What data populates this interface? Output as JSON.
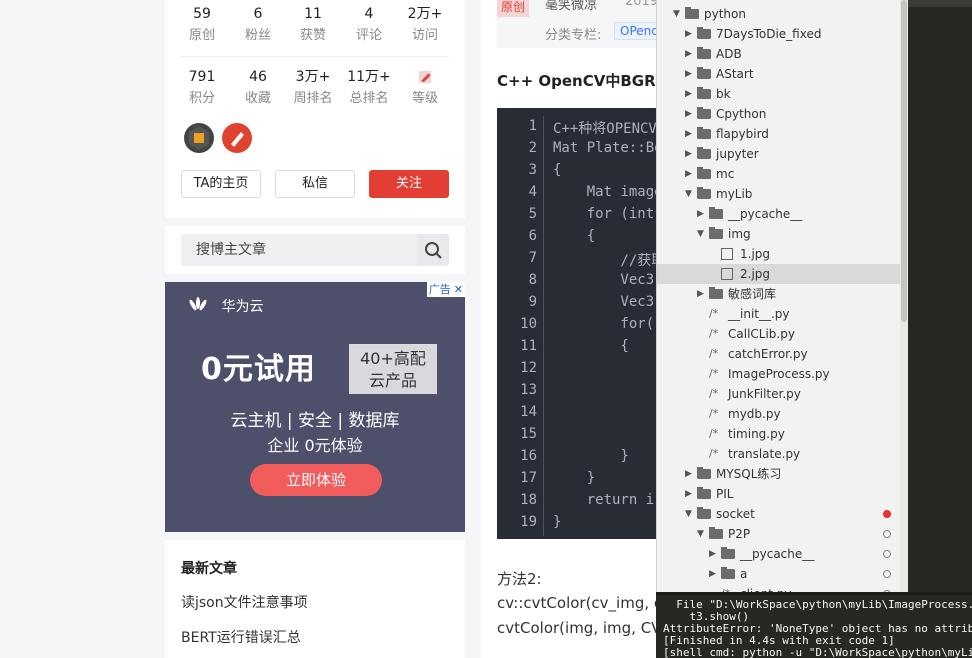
{
  "profile": {
    "row1": [
      {
        "num": "59",
        "label": "原创"
      },
      {
        "num": "6",
        "label": "粉丝"
      },
      {
        "num": "11",
        "label": "获赞"
      },
      {
        "num": "4",
        "label": "评论"
      },
      {
        "num": "2万+",
        "label": "访问"
      }
    ],
    "row2": [
      {
        "num": "791",
        "label": "积分"
      },
      {
        "num": "46",
        "label": "收藏"
      },
      {
        "num": "3万+",
        "label": "周排名"
      },
      {
        "num": "11万+",
        "label": "总排名"
      },
      {
        "num": "",
        "label": "等级"
      }
    ],
    "badge_colors": [
      "#444444",
      "#e0432f"
    ],
    "buttons": {
      "home": "TA的主页",
      "message": "私信",
      "follow": "关注"
    }
  },
  "search": {
    "placeholder": "搜博主文章"
  },
  "ad": {
    "tag": "广告",
    "close": "✕",
    "brand": "华为云",
    "headline": "0元试用",
    "offer_line1": "40+高配",
    "offer_line2": "云产品",
    "line1": "云主机 | 安全 | 数据库",
    "line2": "企业 0元体验",
    "cta": "立即体验"
  },
  "recent": {
    "heading": "最新文章",
    "items": [
      "读json文件注意事项",
      "BERT运行错误汇总"
    ]
  },
  "article": {
    "origin_tag": "原创",
    "author": "毫笑微凉",
    "date": "2019",
    "column_label": "分类专栏:",
    "column_link": "OPenc",
    "title": "C++ OpenCV中BGR转",
    "code_lines": [
      {
        "n": "1",
        "text": "C++种将OPENCV"
      },
      {
        "n": "2",
        "text": "Mat Plate::Be"
      },
      {
        "n": "3",
        "text": "{"
      },
      {
        "n": "4",
        "text": "    Mat image"
      },
      {
        "n": "5",
        "text": "    for (int"
      },
      {
        "n": "6",
        "text": "    {"
      },
      {
        "n": "7",
        "text": "        //获取"
      },
      {
        "n": "8",
        "text": "        Vec3"
      },
      {
        "n": "9",
        "text": "        Vec3"
      },
      {
        "n": "10",
        "text": "        for("
      },
      {
        "n": "11",
        "text": "        {"
      },
      {
        "n": "12",
        "text": ""
      },
      {
        "n": "13",
        "text": ""
      },
      {
        "n": "14",
        "text": ""
      },
      {
        "n": "15",
        "text": ""
      },
      {
        "n": "16",
        "text": "        }"
      },
      {
        "n": "17",
        "text": "    }"
      },
      {
        "n": "18",
        "text": "    return i"
      },
      {
        "n": "19",
        "text": "}"
      }
    ],
    "para_method": "方法2:",
    "para_line1": "cv::cvtColor(cv_img, c",
    "para_line2": "cvtColor(img, img, CV"
  },
  "sidebar": {
    "rows": [
      {
        "name": "python",
        "type": "folder-open",
        "depth": 0
      },
      {
        "name": "7DaysToDie_fixed",
        "type": "folder",
        "depth": 1
      },
      {
        "name": "ADB",
        "type": "folder",
        "depth": 1
      },
      {
        "name": "AStart",
        "type": "folder",
        "depth": 1
      },
      {
        "name": "bk",
        "type": "folder",
        "depth": 1
      },
      {
        "name": "Cpython",
        "type": "folder",
        "depth": 1
      },
      {
        "name": "flapybird",
        "type": "folder",
        "depth": 1
      },
      {
        "name": "jupyter",
        "type": "folder",
        "depth": 1
      },
      {
        "name": "mc",
        "type": "folder",
        "depth": 1
      },
      {
        "name": "myLib",
        "type": "folder-open",
        "depth": 1
      },
      {
        "name": "__pycache__",
        "type": "folder",
        "depth": 2
      },
      {
        "name": "img",
        "type": "folder-open",
        "depth": 2
      },
      {
        "name": "1.jpg",
        "type": "image",
        "depth": 3
      },
      {
        "name": "2.jpg",
        "type": "image",
        "depth": 3,
        "selected": true
      },
      {
        "name": "敏感词库",
        "type": "folder",
        "depth": 2
      },
      {
        "name": "__init__.py",
        "type": "file",
        "depth": 2
      },
      {
        "name": "CallCLib.py",
        "type": "file",
        "depth": 2
      },
      {
        "name": "catchError.py",
        "type": "file",
        "depth": 2
      },
      {
        "name": "ImageProcess.py",
        "type": "file",
        "depth": 2
      },
      {
        "name": "JunkFilter.py",
        "type": "file",
        "depth": 2
      },
      {
        "name": "mydb.py",
        "type": "file",
        "depth": 2
      },
      {
        "name": "timing.py",
        "type": "file",
        "depth": 2
      },
      {
        "name": "translate.py",
        "type": "file",
        "depth": 2
      },
      {
        "name": "MYSQL练习",
        "type": "folder",
        "depth": 1
      },
      {
        "name": "PIL",
        "type": "folder",
        "depth": 1
      },
      {
        "name": "socket",
        "type": "folder-open",
        "depth": 1,
        "marker": "red"
      },
      {
        "name": "P2P",
        "type": "folder-open",
        "depth": 2,
        "marker": "open"
      },
      {
        "name": "__pycache__",
        "type": "folder",
        "depth": 3,
        "marker": "open"
      },
      {
        "name": "a",
        "type": "folder",
        "depth": 3,
        "marker": "open"
      },
      {
        "name": "client.py",
        "type": "file",
        "depth": 3,
        "marker": "open"
      }
    ]
  },
  "console": {
    "lines": [
      "  File \"D:\\WorkSpace\\python\\myLib\\ImageProcess.py\",",
      "    t3.show()",
      "AttributeError: 'NoneType' object has no attribute",
      "[Finished in 4.4s with exit code 1]",
      "[shell_cmd: python -u \"D:\\WorkSpace\\python\\myLib\\Im"
    ]
  },
  "colors": {
    "accent_red": "#e33e33",
    "code_bg": "#282c34",
    "editor_bg": "#272822",
    "ad_bg": "#4d4f6b"
  }
}
